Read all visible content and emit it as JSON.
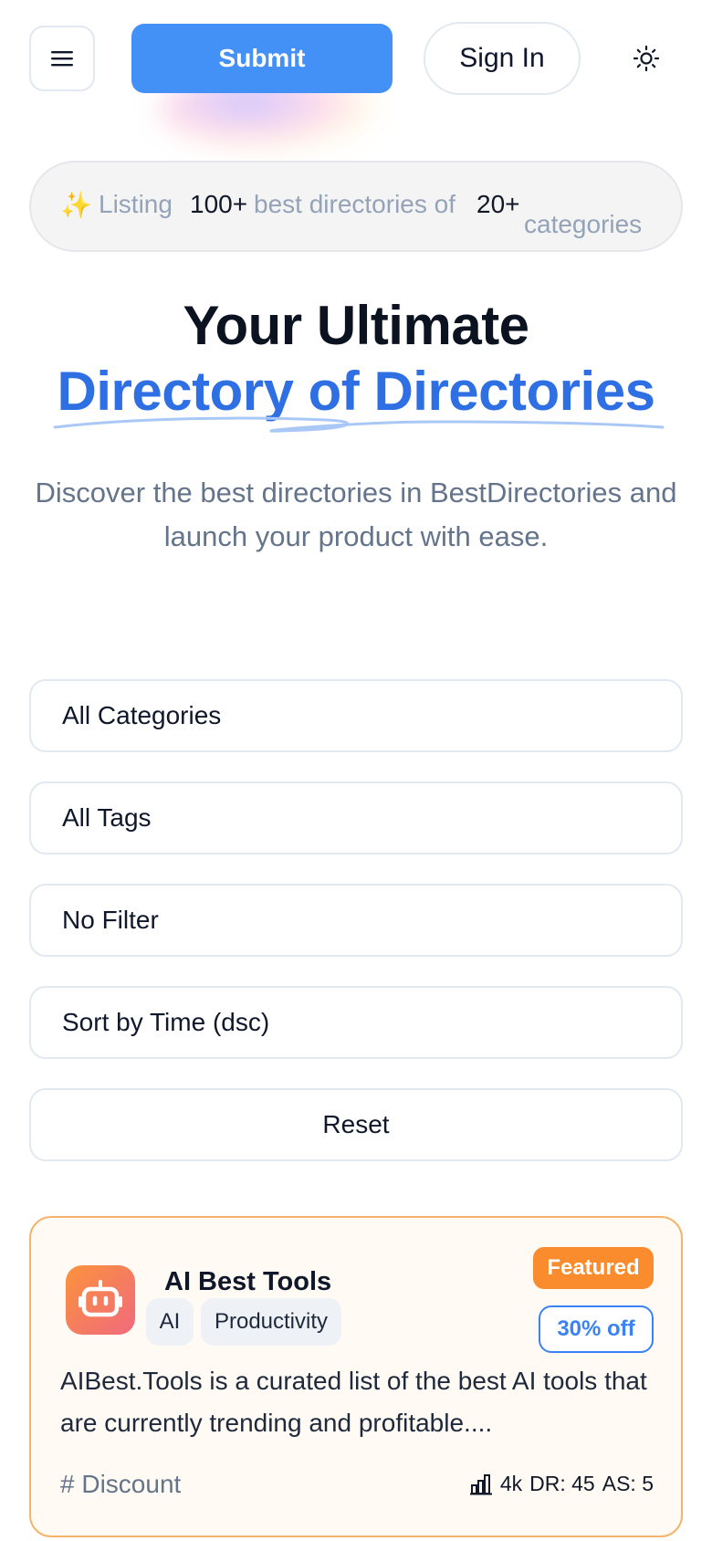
{
  "header": {
    "submit_label": "Submit",
    "signin_label": "Sign In",
    "menu_icon": "hamburger-icon",
    "theme_icon": "sun-icon"
  },
  "banner": {
    "sparkle": "✨",
    "listing": "Listing",
    "count_directories": "100+",
    "middle_text": "best directories of",
    "count_categories": "20+",
    "categories_text": "categories"
  },
  "hero": {
    "title_line1": "Your Ultimate",
    "title_line2": "Directory of Directories",
    "subtitle": "Discover the best directories in BestDirectories and launch your product with ease."
  },
  "filters": {
    "category": "All Categories",
    "tags": "All Tags",
    "filter": "No Filter",
    "sort": "Sort by Time (dsc)",
    "reset": "Reset"
  },
  "card": {
    "title": "AI Best Tools",
    "tags": [
      "AI",
      "Productivity"
    ],
    "featured": "Featured",
    "discount": "30% off",
    "description": "AIBest.Tools is a curated list of the best AI tools that are currently trending and profitable....",
    "tag_link": "# Discount",
    "traffic": "4k",
    "dr": "DR: 45",
    "as": "AS: 5"
  },
  "colors": {
    "accent": "#4391f7",
    "title_blue": "#2f6fe4",
    "featured_orange": "#fb8c2e",
    "card_border": "#f6b46b"
  }
}
